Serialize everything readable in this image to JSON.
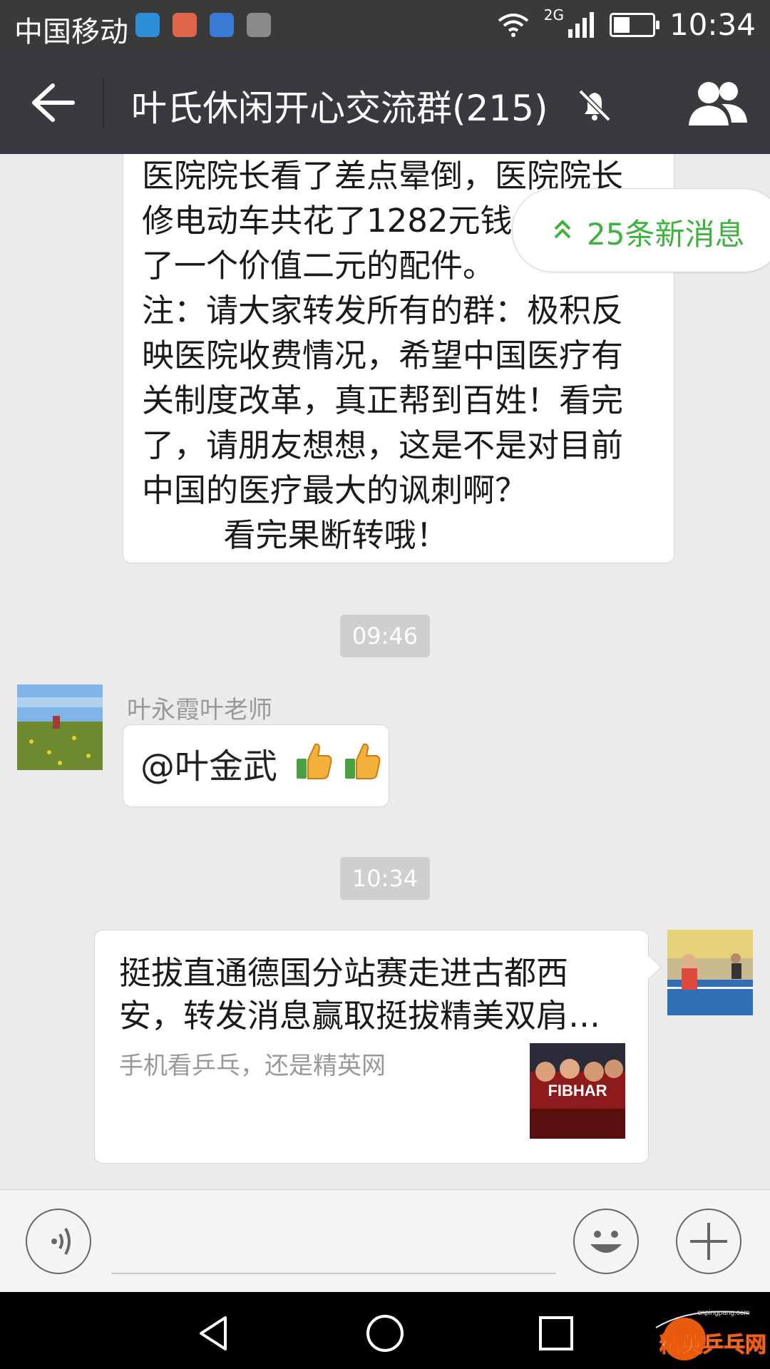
{
  "status_bar": {
    "carrier": "中国移动",
    "network": "2G",
    "time": "10:34"
  },
  "header": {
    "title": "叶氏休闲开心交流群(215)"
  },
  "messages": {
    "long_text": "医院院长看了差点晕倒，医院院长\n修电动车共花了1282元钱，\n了一个价值二元的配件。\n注：请大家转发所有的群：极积反\n映医院收费情况，希望中国医疗有\n关制度改革，真正帮到百姓！看完\n了，请朋友想想，这是不是对目前\n中国的医疗最大的讽刺啊？\n        看完果断转哦！",
    "time_1": "09:46",
    "sender_name": "叶永霞叶老师",
    "mention_text": "@叶金武",
    "time_2": "10:34",
    "link_card": {
      "title": "挺拔直通德国分站赛走进古都西安，转发消息赢取挺拔精美双肩…",
      "description": "手机看乒乓，还是精英网",
      "thumb_text": "FIBHAR"
    }
  },
  "new_messages_pill": "25条新消息",
  "watermark": {
    "text": "精英乒乓网",
    "url": "cnpingpang.com"
  },
  "colors": {
    "accent_green": "#3db33d",
    "header_bg": "#393a3f",
    "chat_bg": "#ebebeb"
  }
}
